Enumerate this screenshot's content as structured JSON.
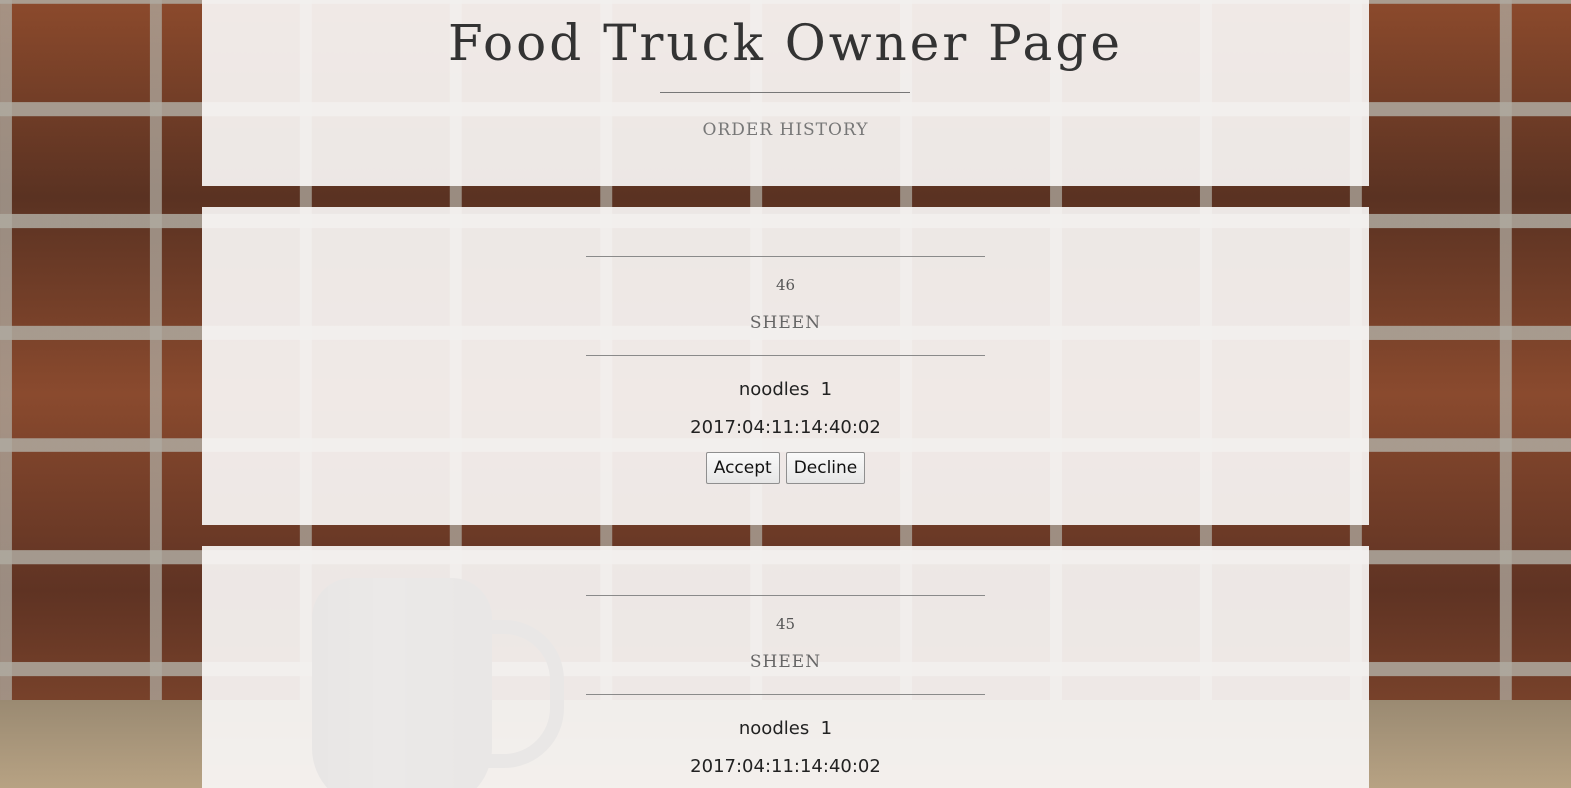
{
  "page": {
    "title": "Food Truck Owner Page",
    "subtitle": "ORDER HISTORY"
  },
  "orders": [
    {
      "id": "46",
      "customer": "SHEEN",
      "item_line": "noodles  1",
      "timestamp": "2017:04:11:14:40:02",
      "accept_label": "Accept",
      "decline_label": "Decline"
    },
    {
      "id": "45",
      "customer": "SHEEN",
      "item_line": "noodles  1",
      "timestamp": "2017:04:11:14:40:02"
    }
  ],
  "background": {
    "description_icon": "brick-wall-background",
    "panel_color": "#f7f5f4"
  }
}
